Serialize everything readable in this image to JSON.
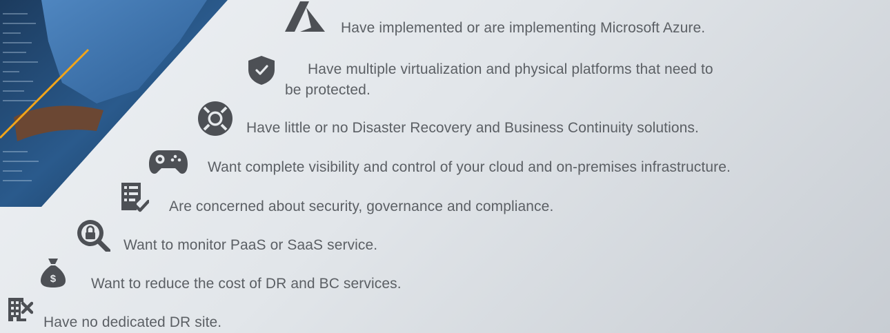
{
  "colors": {
    "text": "#5b5f64",
    "icon": "#4d5055",
    "accent_line": "#f2a51a"
  },
  "items": [
    {
      "icon": "azure-icon",
      "text": "Have implemented or are implementing Microsoft Azure."
    },
    {
      "icon": "shield-check-icon",
      "text": "Have multiple virtualization and physical platforms that need to be protected."
    },
    {
      "icon": "lifebuoy-icon",
      "text": "Have little or no Disaster Recovery and Business Continuity solutions."
    },
    {
      "icon": "gamepad-icon",
      "text": "Want complete visibility and control of your cloud and on-premises infrastructure."
    },
    {
      "icon": "checklist-icon",
      "text": "Are concerned about security, governance and compliance."
    },
    {
      "icon": "lock-search-icon",
      "text": "Want to monitor PaaS or SaaS service."
    },
    {
      "icon": "money-bag-icon",
      "text": "Want to reduce the cost of DR and BC services."
    },
    {
      "icon": "building-x-icon",
      "text": "Have no dedicated DR site."
    }
  ]
}
